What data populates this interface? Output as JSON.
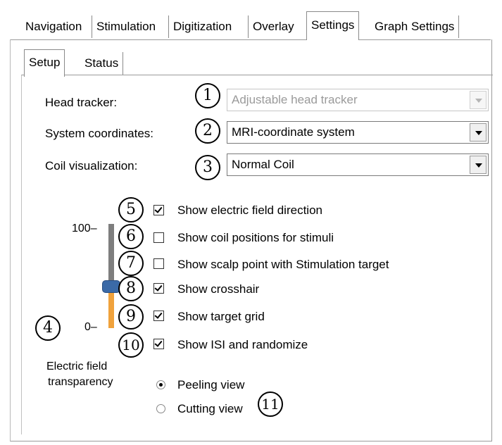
{
  "tabs": [
    {
      "label": "Navigation",
      "active": false
    },
    {
      "label": "Stimulation",
      "active": false
    },
    {
      "label": "Digitization",
      "active": false
    },
    {
      "label": "Overlay",
      "active": false
    },
    {
      "label": "Settings",
      "active": true
    },
    {
      "label": "Graph Settings",
      "active": false
    }
  ],
  "subtabs": [
    {
      "label": "Setup",
      "active": true
    },
    {
      "label": "Status",
      "active": false
    }
  ],
  "fields": {
    "head_tracker": {
      "label": "Head tracker:",
      "value": "Adjustable head tracker",
      "enabled": false,
      "callout": "1"
    },
    "system_coordinates": {
      "label": "System coordinates:",
      "value": "MRI-coordinate system",
      "enabled": true,
      "callout": "2"
    },
    "coil_visualization": {
      "label": "Coil visualization:",
      "value": "Normal Coil",
      "enabled": true,
      "callout": "3"
    }
  },
  "transparency": {
    "callout": "4",
    "label_line1": "Electric field",
    "label_line2": "transparency",
    "tick_max": "100–",
    "tick_min": "0–",
    "value_percent": 35
  },
  "checkboxes": [
    {
      "callout": "5",
      "label": "Show electric field direction",
      "checked": true
    },
    {
      "callout": "6",
      "label": "Show coil positions for stimuli",
      "checked": false
    },
    {
      "callout": "7",
      "label": "Show scalp point with Stimulation target",
      "checked": false
    },
    {
      "callout": "8",
      "label": "Show crosshair",
      "checked": true
    },
    {
      "callout": "9",
      "label": "Show target grid",
      "checked": true
    },
    {
      "callout": "10",
      "label": "Show ISI and randomize",
      "checked": true
    }
  ],
  "view_mode": {
    "callout": "11",
    "options": [
      {
        "label": "Peeling view",
        "selected": true
      },
      {
        "label": "Cutting view",
        "selected": false
      }
    ]
  }
}
